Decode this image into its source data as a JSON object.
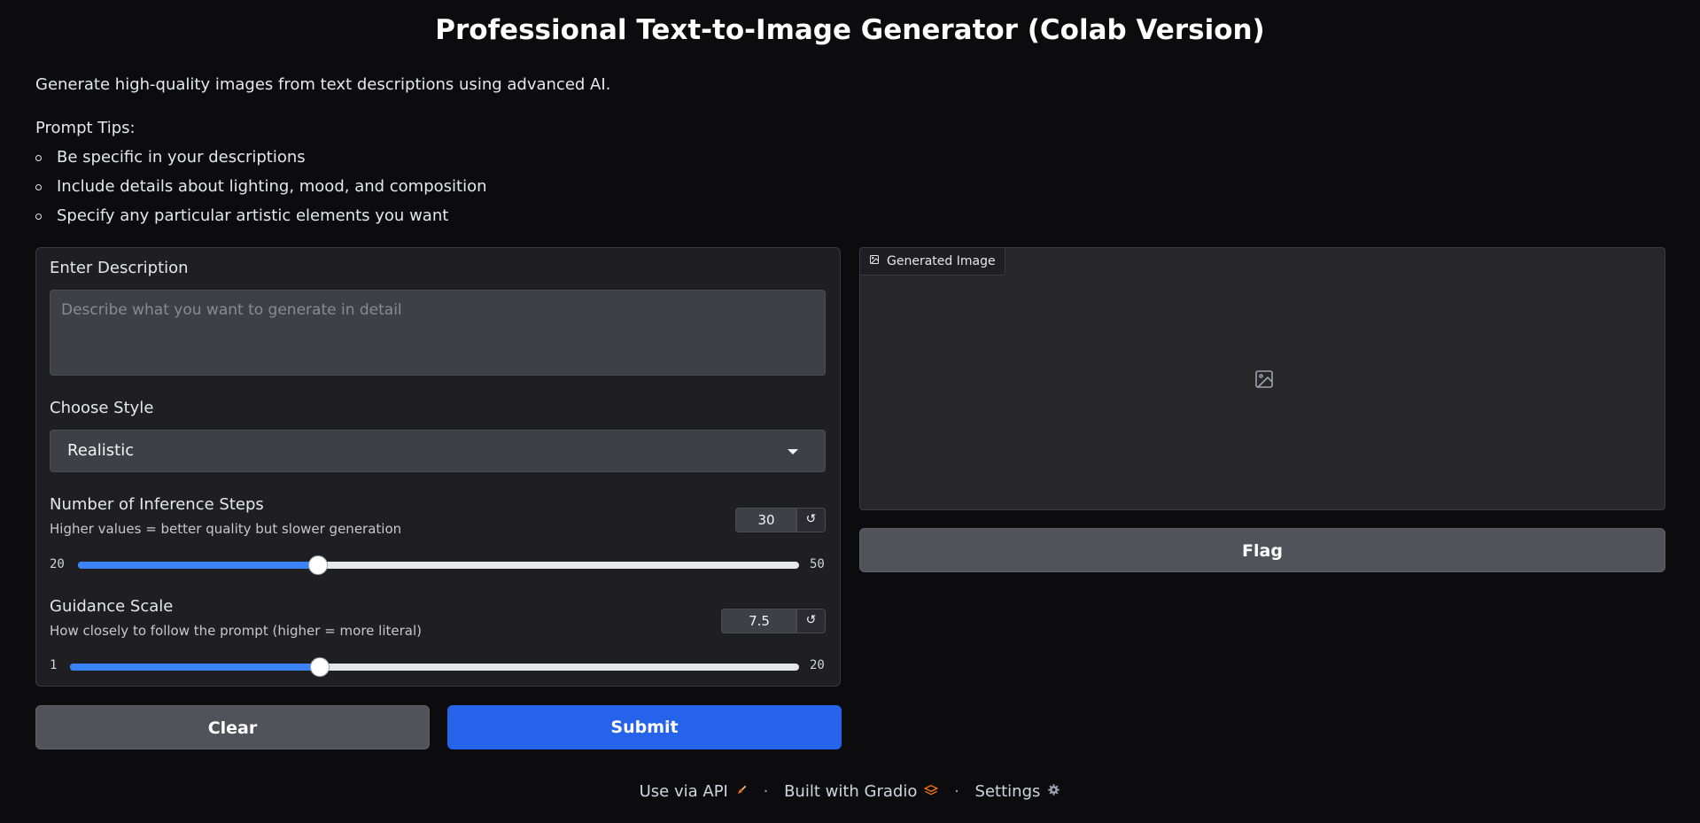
{
  "header": {
    "title": "Professional Text-to-Image Generator (Colab Version)",
    "description": "Generate high-quality images from text descriptions using advanced AI.",
    "tips_heading": "Prompt Tips:",
    "tips": [
      "Be specific in your descriptions",
      "Include details about lighting, mood, and composition",
      "Specify any particular artistic elements you want"
    ]
  },
  "form": {
    "description": {
      "label": "Enter Description",
      "placeholder": "Describe what you want to generate in detail",
      "value": ""
    },
    "style": {
      "label": "Choose Style",
      "selected": "Realistic"
    },
    "steps": {
      "label": "Number of Inference Steps",
      "info": "Higher values = better quality but slower generation",
      "value": "30",
      "min": "20",
      "max": "50",
      "fraction": 0.3333
    },
    "guidance": {
      "label": "Guidance Scale",
      "info": "How closely to follow the prompt (higher = more literal)",
      "value": "7.5",
      "min": "1",
      "max": "20",
      "fraction": 0.3421
    }
  },
  "buttons": {
    "clear": "Clear",
    "submit": "Submit",
    "flag": "Flag"
  },
  "output": {
    "label": "Generated Image"
  },
  "footer": {
    "api": "Use via API",
    "built": "Built with Gradio",
    "settings": "Settings",
    "separator": "·"
  },
  "icons": {
    "reset": "reset-icon",
    "image": "image-icon",
    "rocket": "rocket-icon",
    "gradio": "gradio-logo-icon",
    "settings": "gear-icon"
  },
  "colors": {
    "accent": "#2563eb",
    "slider_fill": "#3b82f6",
    "background": "#0c0c0f"
  }
}
